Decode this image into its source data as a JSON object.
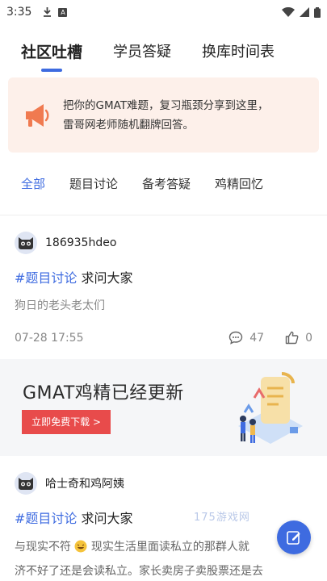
{
  "status_bar": {
    "time": "3:35"
  },
  "top_tabs": [
    {
      "label": "社区吐槽"
    },
    {
      "label": "学员答疑"
    },
    {
      "label": "换库时间表"
    }
  ],
  "notice": {
    "line1": "把你的GMAT难题，复习瓶颈分享到这里，",
    "line2": "雷哥网老师随机翻牌回答。"
  },
  "category_tabs": [
    {
      "label": "全部"
    },
    {
      "label": "题目讨论"
    },
    {
      "label": "备考答疑"
    },
    {
      "label": "鸡精回忆"
    }
  ],
  "posts": [
    {
      "username": "186935hdeo",
      "tag": "#题目讨论",
      "title": "求问大家",
      "body": "狗日的老头老太们",
      "date": "07-28 17:55",
      "comments": "47",
      "likes": "0"
    },
    {
      "username": "哈士奇和鸡阿姨",
      "tag": "#题目讨论",
      "title": "求问大家",
      "body_line1_a": "与现实不符",
      "body_line1_b": "现实生活里面读私立的那群人就",
      "body_line2": "济不好了还是会读私立。家长卖房子卖股票还是去"
    }
  ],
  "banner": {
    "title": "GMAT鸡精已经更新",
    "button": "立即免费下载 >"
  },
  "watermark": "175游戏网",
  "colors": {
    "accent": "#3e6be0",
    "notice_bg": "#fdf0ea",
    "banner_button": "#e84b4b"
  }
}
